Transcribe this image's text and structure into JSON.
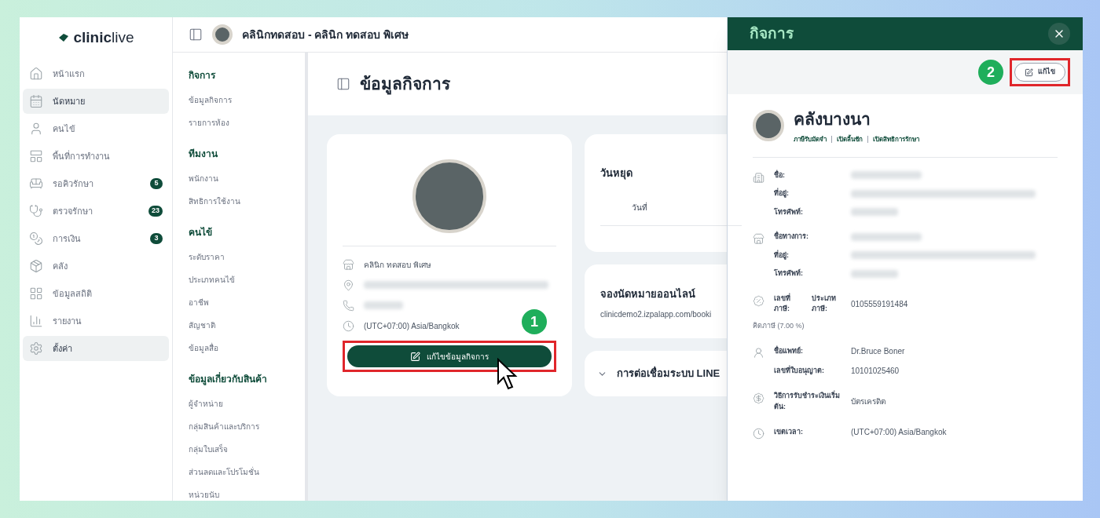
{
  "brand": {
    "name_bold": "clinic",
    "name_light": "live"
  },
  "sidebar": {
    "items": [
      {
        "label": "หน้าแรก",
        "selected": false
      },
      {
        "label": "นัดหมาย",
        "selected": true
      },
      {
        "label": "คนไข้",
        "selected": false
      },
      {
        "label": "พื้นที่การทำงาน",
        "selected": false
      },
      {
        "label": "รอคิวรักษา",
        "selected": false,
        "count": "5"
      },
      {
        "label": "ตรวจรักษา",
        "selected": false,
        "count": "23"
      },
      {
        "label": "การเงิน",
        "selected": false,
        "count": "3"
      },
      {
        "label": "คลัง",
        "selected": false
      },
      {
        "label": "ข้อมูลสถิติ",
        "selected": false
      },
      {
        "label": "รายงาน",
        "selected": false
      },
      {
        "label": "ตั้งค่า",
        "selected": true
      }
    ]
  },
  "header": {
    "title": "คลินิกทดสอบ - คลินิก ทดสอบ พิเศษ"
  },
  "settings_menu": [
    {
      "heading": "กิจการ",
      "items": [
        "ข้อมูลกิจการ",
        "รายการห้อง"
      ]
    },
    {
      "heading": "ทีมงาน",
      "items": [
        "พนักงาน",
        "สิทธิการใช้งาน"
      ]
    },
    {
      "heading": "คนไข้",
      "items": [
        "ระดับราคา",
        "ประเภทคนไข้",
        "อาชีพ",
        "สัญชาติ",
        "ข้อมูลสื่อ"
      ]
    },
    {
      "heading": "ข้อมูลเกี่ยวกับสินค้า",
      "items": [
        "ผู้จำหน่าย",
        "กลุ่มสินค้าและบริการ",
        "กลุ่มใบเสร็จ",
        "ส่วนลดและโปรโมชั่น",
        "หน่วยนับ"
      ]
    }
  ],
  "page": {
    "title": "ข้อมูลกิจการ",
    "business_card": {
      "rows": [
        {
          "kind": "text",
          "value": "คลินิก ทดสอบ พิเศษ"
        },
        {
          "kind": "blurred"
        },
        {
          "kind": "blurred"
        },
        {
          "kind": "text",
          "value": "(UTC+07:00) Asia/Bangkok"
        }
      ],
      "edit_button": "แก้ไขข้อมูลกิจการ",
      "step": "1"
    },
    "holidays": {
      "title": "วันหยุด",
      "column": "วันที่"
    },
    "online_booking": {
      "title": "จองนัดหมายออนไลน์",
      "url": "clinicdemo2.izpalapp.com/booki"
    },
    "line": {
      "title": "การต่อเชื่อมระบบ LINE",
      "expanded": false
    }
  },
  "drawer": {
    "title": "กิจการ",
    "step": "2",
    "edit_button": "แก้ไข",
    "name": "คลังบางนา",
    "links": [
      "ภาษีรับมัดจำ",
      "เปิดลิ้นชัก",
      "เปิดสิทธิการรักษา"
    ],
    "groups": [
      {
        "rows": [
          {
            "label": "ชื่อ:",
            "kind": "blurred"
          },
          {
            "label": "ที่อยู่:",
            "kind": "blurred"
          },
          {
            "label": "โทรศัพท์:",
            "kind": "blurred"
          }
        ]
      },
      {
        "rows": [
          {
            "label": "ชื่อทางการ:",
            "kind": "blurred"
          },
          {
            "label": "ที่อยู่:",
            "kind": "blurred"
          },
          {
            "label": "โทรศัพท์:",
            "kind": "blurred"
          }
        ]
      },
      {
        "rows": [
          {
            "label": "เลขที่ภาษี:",
            "label2": "ประเภทภาษี:",
            "kind": "text",
            "value": "0105559191484"
          }
        ],
        "note": "คิดภาษี (7.00 %)"
      },
      {
        "rows": [
          {
            "label": "ชื่อแพทย์:",
            "kind": "text",
            "value": "Dr.Bruce Boner"
          },
          {
            "label": "เลขที่ใบอนุญาต:",
            "kind": "text",
            "value": "10101025460"
          }
        ]
      },
      {
        "rows": [
          {
            "label": "วิธีการรับชำระเงินเริ่มต้น:",
            "kind": "text",
            "value": "บัตรเครดิต"
          }
        ]
      },
      {
        "rows": [
          {
            "label": "เขตเวลา:",
            "kind": "text",
            "value": "(UTC+07:00) Asia/Bangkok"
          }
        ]
      }
    ]
  }
}
